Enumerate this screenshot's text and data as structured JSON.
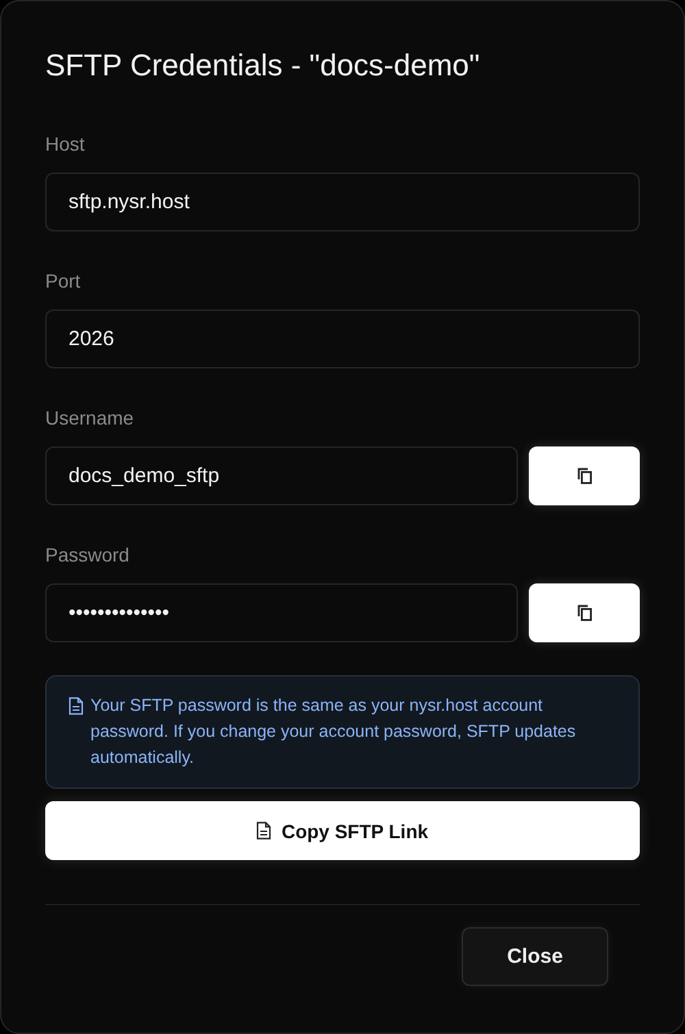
{
  "dialog": {
    "title": "SFTP Credentials - \"docs-demo\""
  },
  "fields": [
    {
      "label": "Host",
      "value": "sftp.nysr.host",
      "kind": "plain"
    },
    {
      "label": "Port",
      "value": "2026",
      "kind": "plain"
    },
    {
      "label": "Username",
      "value": "docs_demo_sftp",
      "kind": "copyable"
    },
    {
      "label": "Password",
      "value": "••••••••••••••",
      "kind": "copyable"
    }
  ],
  "notice": {
    "text": "Your SFTP password is the same as your nysr.host account password. If you change your account password, SFTP updates automatically."
  },
  "copy_link_button": {
    "label": "Copy SFTP Link"
  },
  "close_button": {
    "label": "Close"
  }
}
